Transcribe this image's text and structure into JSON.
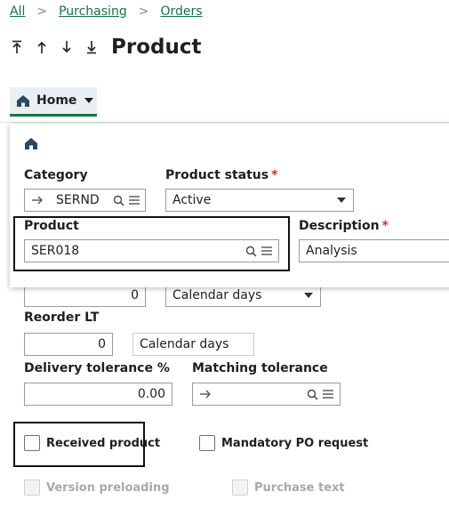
{
  "breadcrumb": {
    "items": [
      "All",
      "Purchasing",
      "Orders"
    ]
  },
  "header": {
    "title": "Product"
  },
  "tabs": {
    "home_label": "Home"
  },
  "popup": {
    "category": {
      "label": "Category",
      "value": "SERND"
    },
    "product_status": {
      "label": "Product status",
      "required_mark": "*",
      "value": "Active"
    },
    "product": {
      "label": "Product",
      "value": "SER018"
    },
    "description": {
      "label": "Description",
      "required_mark": "*",
      "value": "Analysis"
    }
  },
  "form": {
    "lead_time": {
      "value": "0",
      "unit": "Calendar days"
    },
    "reorder_lt": {
      "label": "Reorder LT",
      "value": "0",
      "unit": "Calendar days"
    },
    "delivery_tolerance": {
      "label": "Delivery tolerance %",
      "value": "0.00"
    },
    "matching_tolerance": {
      "label": "Matching tolerance",
      "value": ""
    },
    "received_product": {
      "label": "Received product",
      "checked": false
    },
    "mandatory_po_request": {
      "label": "Mandatory PO request",
      "checked": false
    },
    "version_preloading": {
      "label": "Version preloading",
      "checked": false,
      "disabled": true
    },
    "purchase_text": {
      "label": "Purchase text",
      "checked": false,
      "disabled": true
    }
  },
  "colors": {
    "accent": "#197345",
    "required": "#d0332b",
    "tab_bg": "#e9f0f4"
  },
  "icons": [
    "arrow-to-top-icon",
    "arrow-up-icon",
    "arrow-down-icon",
    "arrow-to-bottom-icon",
    "home-icon",
    "link-arrow-icon",
    "search-icon",
    "list-menu-icon",
    "chevron-down-icon"
  ]
}
